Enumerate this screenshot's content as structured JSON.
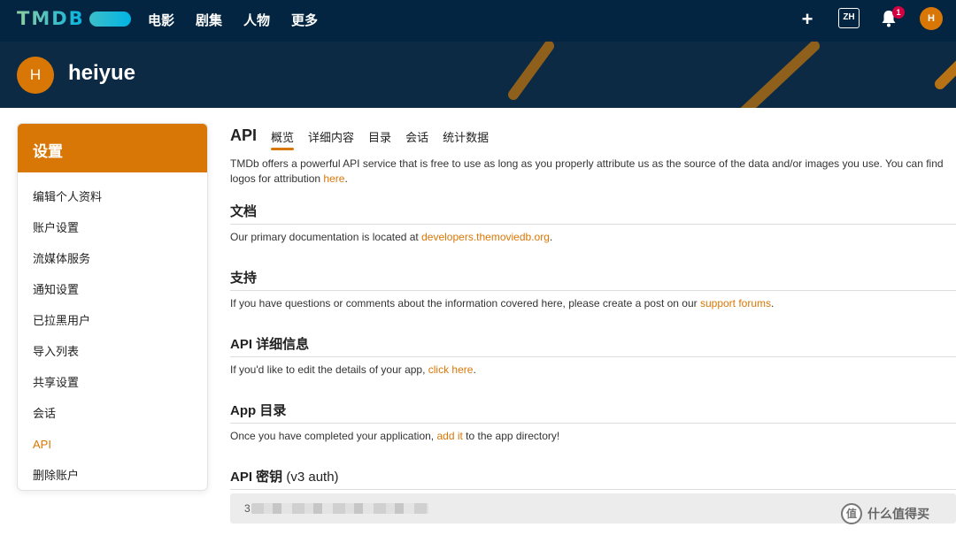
{
  "nav": {
    "logo": "TMDB",
    "links": [
      "电影",
      "剧集",
      "人物",
      "更多"
    ],
    "lang": "ZH",
    "notifications": "1",
    "avatar_initial": "H"
  },
  "profile": {
    "initial": "H",
    "name": "heiyue"
  },
  "sidebar": {
    "title": "设置",
    "items": [
      "编辑个人资料",
      "账户设置",
      "流媒体服务",
      "通知设置",
      "已拉黑用户",
      "导入列表",
      "共享设置",
      "会话",
      "API",
      "删除账户"
    ],
    "active": "API"
  },
  "main": {
    "title": "API",
    "tabs": [
      "概览",
      "详细内容",
      "目录",
      "会话",
      "统计数据"
    ],
    "active_tab": "概览",
    "intro": {
      "text": "TMDb offers a powerful API service that is free to use as long as you properly attribute us as the source of the data and/or images you use. You can find",
      "line2": "logos for attribution ",
      "link": "here",
      "end": "."
    },
    "sections": {
      "docs": {
        "title": "文档",
        "text": "Our primary documentation is located at ",
        "link": "developers.themoviedb.org",
        "end": "."
      },
      "support": {
        "title": "支持",
        "text": "If you have questions or comments about the information covered here, please create a post on our ",
        "link": "support forums",
        "end": "."
      },
      "details": {
        "title": "API 详细信息",
        "text": "If you'd like to edit the details of your app, ",
        "link": "click here",
        "end": "."
      },
      "directory": {
        "title": "App 目录",
        "text": "Once you have completed your application, ",
        "link": "add it",
        "end": " to the app directory!"
      },
      "key": {
        "title": "API 密钥",
        "subtitle": "(v3 auth)",
        "value_prefix": "3"
      }
    }
  },
  "watermark": {
    "icon": "值",
    "text": "什么值得买"
  },
  "colors": {
    "nav_bg": "#032541",
    "accent": "#d97706",
    "badge": "#d40242"
  }
}
